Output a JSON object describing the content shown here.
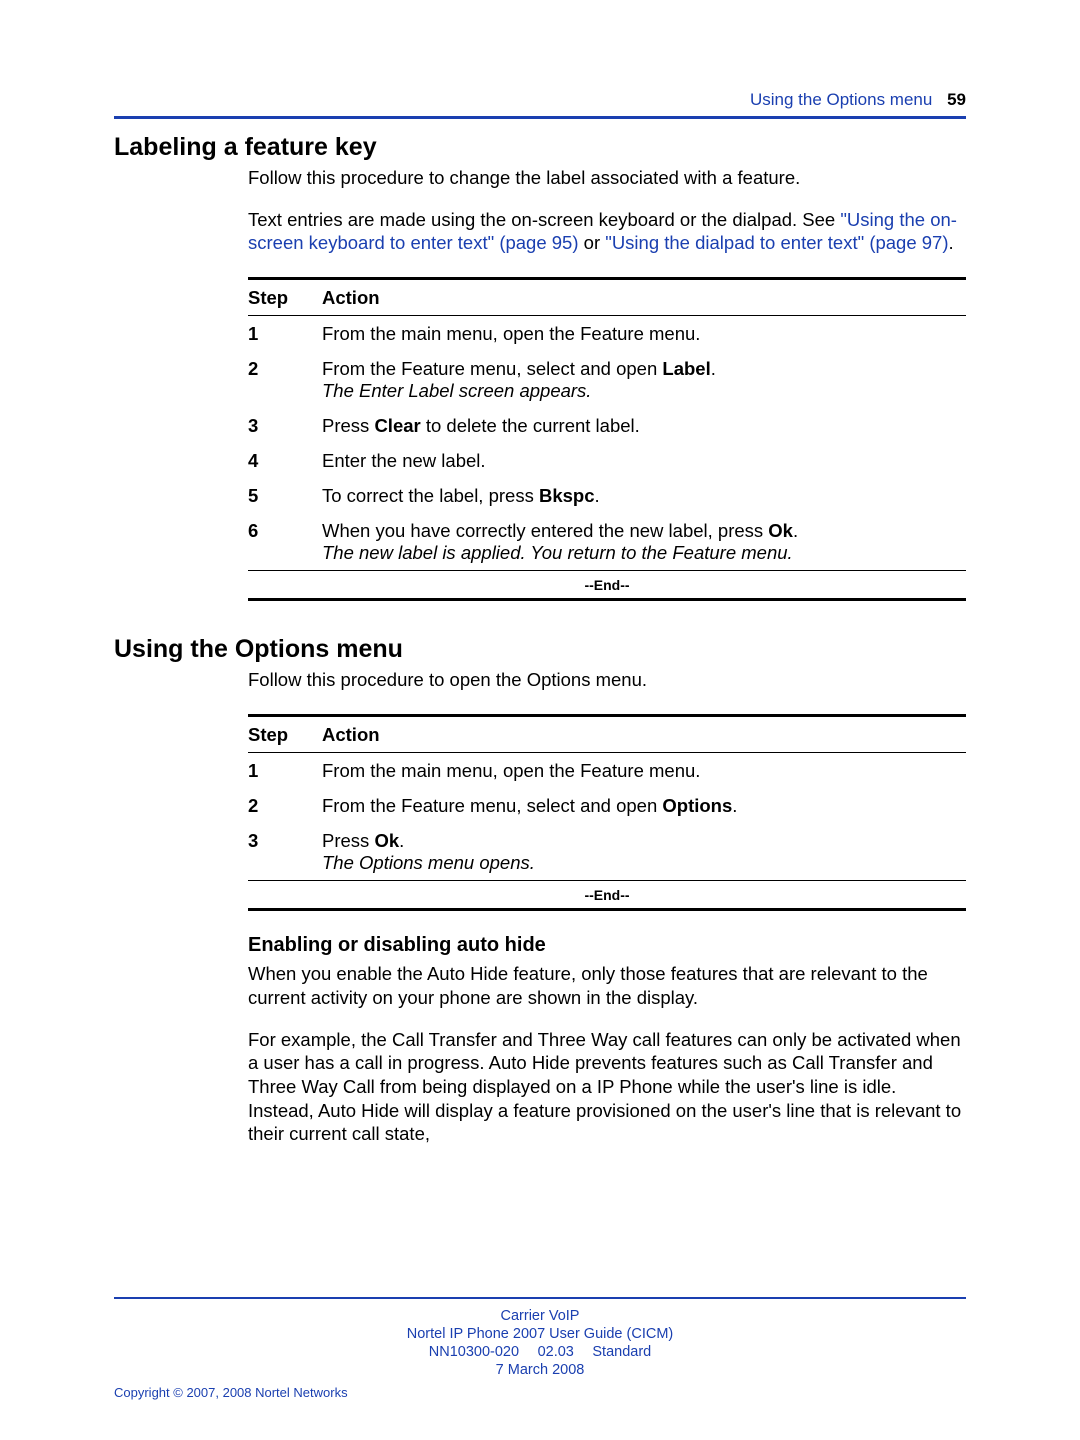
{
  "running_head": {
    "title": "Using the Options menu",
    "page": "59"
  },
  "section1": {
    "heading": "Labeling a feature key",
    "intro": "Follow this procedure to change the label associated with a feature.",
    "para_pre": "Text entries are made using the on-screen keyboard or the dialpad. See ",
    "link1": "\"Using the on-screen keyboard to enter text\" (page 95)",
    "mid": " or ",
    "link2": "\"Using the dialpad to enter text\" (page 97)",
    "post": ".",
    "table": {
      "head_step": "Step",
      "head_action": "Action",
      "rows": [
        {
          "n": "1",
          "html": "From the main menu, open the Feature menu."
        },
        {
          "n": "2",
          "html": "From the Feature menu, select and open <b>Label</b>.<br><em>The Enter Label screen appears.</em>"
        },
        {
          "n": "3",
          "html": "Press <b>Clear</b> to delete the current label."
        },
        {
          "n": "4",
          "html": "Enter the new label."
        },
        {
          "n": "5",
          "html": "To correct the label, press <b>Bkspc</b>."
        },
        {
          "n": "6",
          "html": "When you have correctly entered the new label, press <b>Ok</b>.<br><em>The new label is applied. You return to the Feature menu.</em>"
        }
      ],
      "end": "--End--"
    }
  },
  "section2": {
    "heading": "Using the Options menu",
    "intro": "Follow this procedure to open the Options menu.",
    "table": {
      "head_step": "Step",
      "head_action": "Action",
      "rows": [
        {
          "n": "1",
          "html": "From the main menu, open the Feature menu."
        },
        {
          "n": "2",
          "html": "From the Feature menu, select and open <b>Options</b>."
        },
        {
          "n": "3",
          "html": "Press <b>Ok</b>.<br><em>The Options menu opens.</em>"
        }
      ],
      "end": "--End--"
    }
  },
  "section3": {
    "heading": "Enabling or disabling auto hide",
    "p1": "When you enable the Auto Hide feature, only those features that are relevant to the current activity on your phone are shown in the display.",
    "p2": "For example, the Call Transfer and Three Way call features can only be activated when a user has a call in progress. Auto Hide prevents features such as Call Transfer and Three Way Call from being displayed on a IP Phone while the user's line is idle. Instead, Auto Hide will display a feature provisioned on the user's line that is relevant to their current call state,"
  },
  "footer": {
    "l1": "Carrier VoIP",
    "l2": "Nortel IP Phone 2007 User Guide (CICM)",
    "l3": "NN10300-020  02.03  Standard",
    "l4": "7 March 2008",
    "copyright": "Copyright © 2007, 2008 Nortel Networks"
  }
}
